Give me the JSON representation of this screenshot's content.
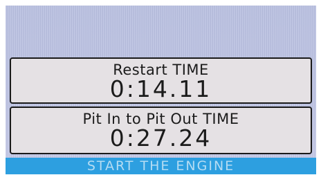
{
  "restart": {
    "label": "Restart TIME",
    "value": "0:14.11"
  },
  "pit": {
    "label": "Pit In to Pit Out TIME",
    "value": "0:27.24"
  },
  "start_button": {
    "label": "START THE ENGINE"
  },
  "colors": {
    "background": "#bcc2e2",
    "panel": "#e5e1e4",
    "border": "#1a1a1a",
    "button": "#2d9fe0",
    "button_text": "#b5dcf3"
  }
}
